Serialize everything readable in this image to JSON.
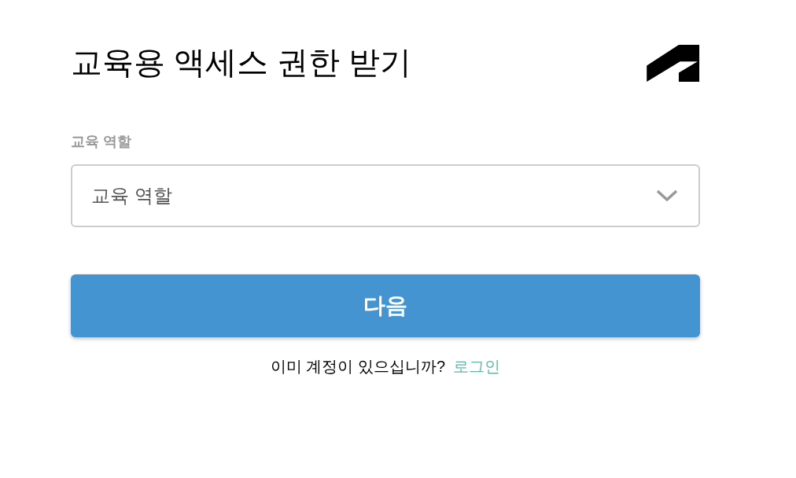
{
  "header": {
    "title": "교육용 액세스 권한 받기"
  },
  "form": {
    "role_field": {
      "label": "교육 역할",
      "placeholder": "교육 역할"
    },
    "next_button": {
      "label": "다음"
    }
  },
  "signin_prompt": {
    "text": "이미 계정이 있으십니까?",
    "link": "로그인"
  }
}
